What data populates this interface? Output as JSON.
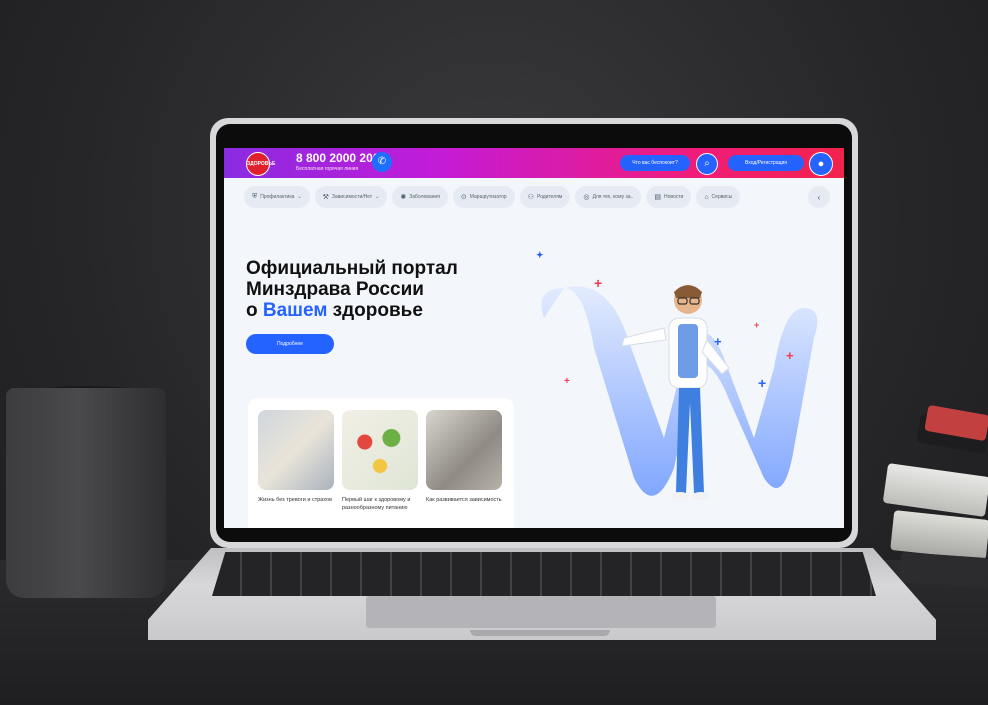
{
  "header": {
    "phone": "8 800 2000 200",
    "phone_sub": "Бесплатная горячая линия",
    "worry_button": "Что вас беспокоит?",
    "login_button": "Вход/Регистрация"
  },
  "nav": [
    {
      "label": "Профилактика",
      "icon": "shield-icon",
      "caret": "⌄"
    },
    {
      "label": "Зависимости/Нет",
      "icon": "tools-icon",
      "caret": "⌄"
    },
    {
      "label": "Заболевания",
      "icon": "virus-icon"
    },
    {
      "label": "Маршрутизатор",
      "icon": "pin-icon"
    },
    {
      "label": "Родителям",
      "icon": "family-icon"
    },
    {
      "label": "Для тех, кому за..",
      "icon": "age-icon"
    },
    {
      "label": "Новости",
      "icon": "news-icon"
    },
    {
      "label": "Сервисы",
      "icon": "services-icon"
    }
  ],
  "hero": {
    "line1": "Официальный портал",
    "line2": "Минздрава России",
    "line3_pre": "о ",
    "line3_accent": "Вашем",
    "line3_post": " здоровье",
    "more_button": "Подробнее"
  },
  "cards": [
    {
      "title": "Жизнь без тревоги и страхов"
    },
    {
      "title": "Первый шаг к здоровому и разнообразному питанию"
    },
    {
      "title": "Как развивается зависимость"
    }
  ],
  "colors": {
    "accent": "#2463ff",
    "plus_red": "#f03a52"
  }
}
